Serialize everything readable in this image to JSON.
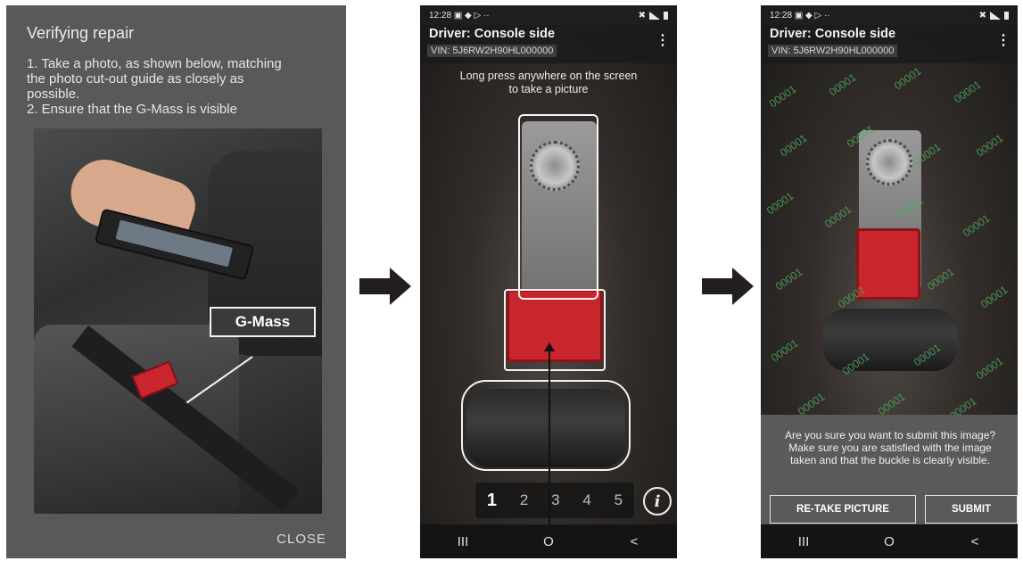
{
  "dialog": {
    "title": "Verifying repair",
    "instructions": [
      "1. Take a photo, as shown below, matching\nthe photo cut-out guide as closely as\npossible.",
      "2. Ensure that the G-Mass is visible"
    ],
    "photo_callout": "G-Mass",
    "close_label": "CLOSE"
  },
  "camera_screen": {
    "status_time": "12:28",
    "status_icons_left": "▣ ◆ ▷ ··",
    "title": "Driver: Console side",
    "vin": "VIN: 5J6RW2H90HL000000",
    "menu_icon": "⋮",
    "hint": "Long press anywhere on the screen\nto take a picture",
    "pages": [
      "1",
      "2",
      "3",
      "4",
      "5"
    ],
    "active_page": "1",
    "info_icon": "i",
    "nav": [
      "III",
      "O",
      "<"
    ]
  },
  "confirm_screen": {
    "status_time": "12:28",
    "status_icons_left": "▣ ◆ ▷ ··",
    "title": "Driver: Console side",
    "vin": "VIN: 5J6RW2H90HL000000",
    "menu_icon": "⋮",
    "watermark": "00001",
    "message": "Are you sure you want to submit this image?\nMake sure you are satisfied with the image\ntaken and that the buckle is clearly visible.",
    "retake_label": "RE-TAKE PICTURE",
    "submit_label": "SUBMIT",
    "nav": [
      "III",
      "O",
      "<"
    ]
  }
}
